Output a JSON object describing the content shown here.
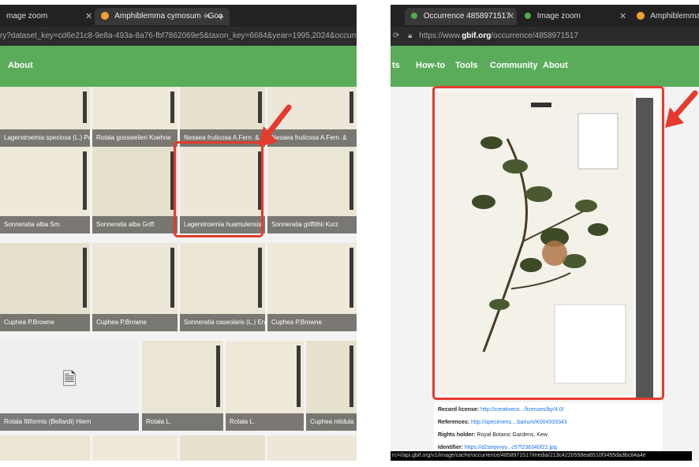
{
  "left_browser": {
    "tabs": [
      {
        "label": "mage zoom",
        "active": false
      },
      {
        "label": "Amphiblemma cymosum - Goo",
        "active": true
      }
    ],
    "url": "ry?dataset_key=cd6e21c8-9e8a-493a-8a76-fbf7862069e5&taxon_key=6684&year=1995,2024&occurrence",
    "nav": [
      "About"
    ],
    "grid": [
      {
        "caption": "Lagerstroemia speciosa (L.) Pers."
      },
      {
        "caption": "Rotala gossweileri Koehne"
      },
      {
        "caption": "Nesaea fruticosa A.Fern. & Diniz"
      },
      {
        "caption": "Nesaea fruticosa A.Fern. &"
      },
      {
        "caption": "Sonneratia alba Sm."
      },
      {
        "caption": "Sonneratia alba Griff."
      },
      {
        "caption": "Lagerstroemia huamulensis"
      },
      {
        "caption": "Sonneratia griffithii Kurz"
      },
      {
        "caption": "Cuphea P.Browne"
      },
      {
        "caption": "Cuphea P.Browne"
      },
      {
        "caption": "Sonneratia caseolaris (L.) Engl."
      },
      {
        "caption": "Cuphea P.Browne"
      },
      {
        "caption": "Rotala filiformis (Bellardi) Hiern"
      },
      {
        "caption": "Rotala L."
      },
      {
        "caption": "Rotala L."
      },
      {
        "caption": "Cuphea nitidula"
      },
      {
        "caption": ""
      },
      {
        "caption": ""
      },
      {
        "caption": ""
      },
      {
        "caption": ""
      }
    ]
  },
  "right_browser": {
    "tabs": [
      {
        "label": "Occurrence 4858971517",
        "active": true
      },
      {
        "label": "Image zoom",
        "active": false
      },
      {
        "label": "Amphiblemma",
        "active": false
      }
    ],
    "url_prefix": "https://www.",
    "url_domain": "gbif.org",
    "url_suffix": "/occurrence/4858971517",
    "nav": [
      "ts",
      "How-to",
      "Tools",
      "Community",
      "About"
    ],
    "details": [
      {
        "key": "Record license:",
        "value": "http://creativeco.../licenses/by/4.0/"
      },
      {
        "key": "References:",
        "value": "http://specimens....barium/K004333343"
      },
      {
        "key": "Rights holder:",
        "value": "Royal Botanic Gardens, Kew"
      },
      {
        "key": "Identifier:",
        "value": "https://d2seqvvyy...c57f23634bf22.jpg"
      }
    ],
    "status_url": "rc=//api.gbif.org/v1/image/cache/occurrence/4858971517/media/213c4220558ea6510f3455da3bc84a4e"
  },
  "colors": {
    "nav_green": "#5aac5a",
    "highlight_red": "#e53a2e",
    "link_blue": "#1a73e8"
  }
}
